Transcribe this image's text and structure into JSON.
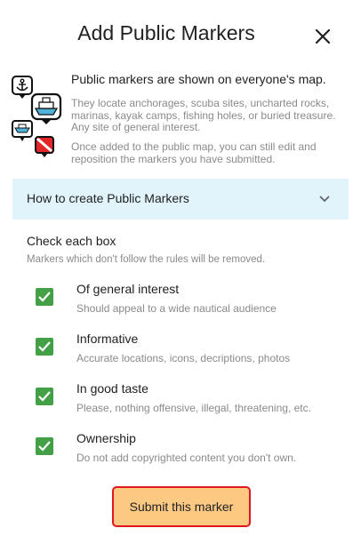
{
  "dialog": {
    "title": "Add Public Markers",
    "close_icon": "close-icon"
  },
  "intro": {
    "icons": [
      "anchor-icon",
      "boat-icon",
      "boat-ramp-icon",
      "dive-flag-icon"
    ],
    "headline": "Public markers are shown on everyone's map.",
    "description": "They locate anchorages, scuba sites, uncharted rocks, marinas, kayak camps, fishing holes, or buried treasure. Any site of general interest.",
    "edit_note": "Once added to the public map, you can still edit and reposition the markers you have submitted."
  },
  "howto": {
    "label": "How to create Public Markers",
    "icon": "chevron-down-icon"
  },
  "checklist": {
    "title": "Check each box",
    "subtitle": "Markers which don't follow the rules will be removed.",
    "items": [
      {
        "label": "Of general interest",
        "desc": "Should appeal to a wide nautical audience",
        "checked": true
      },
      {
        "label": "Informative",
        "desc": "Accurate locations, icons, decriptions, photos",
        "checked": true
      },
      {
        "label": "In good taste",
        "desc": "Please, nothing offensive, illegal, threatening, etc.",
        "checked": true
      },
      {
        "label": "Ownership",
        "desc": "Do not add copyrighted content you don't own.",
        "checked": true
      }
    ]
  },
  "submit": {
    "label": "Submit this marker"
  },
  "colors": {
    "accent_bar": "#e1f4fb",
    "checkbox": "#43a047",
    "submit_fill": "#fcc982",
    "submit_border": "#e0181e"
  }
}
